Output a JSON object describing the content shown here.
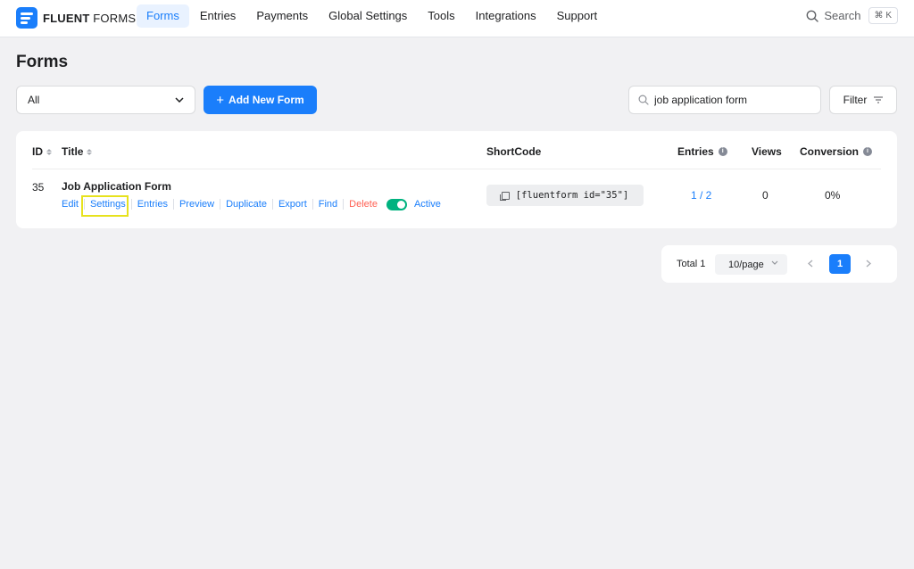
{
  "brand": {
    "name_bold": "FLUENT",
    "name_rest": " FORMS"
  },
  "nav": {
    "items": [
      {
        "label": "Forms",
        "active": true
      },
      {
        "label": "Entries"
      },
      {
        "label": "Payments"
      },
      {
        "label": "Global Settings"
      },
      {
        "label": "Tools"
      },
      {
        "label": "Integrations"
      },
      {
        "label": "Support"
      }
    ],
    "search_label": "Search",
    "search_shortcut": "⌘ K"
  },
  "page": {
    "title": "Forms"
  },
  "toolbar": {
    "filter_select_value": "All",
    "add_button_label": "Add New Form",
    "search_value": "job application form",
    "filter_label": "Filter"
  },
  "table": {
    "columns": {
      "id": "ID",
      "title": "Title",
      "shortcode": "ShortCode",
      "entries": "Entries",
      "views": "Views",
      "conversion": "Conversion"
    },
    "rows": [
      {
        "id": "35",
        "title": "Job Application Form",
        "actions": [
          "Edit",
          "Settings",
          "Entries",
          "Preview",
          "Duplicate",
          "Export",
          "Find",
          "Delete"
        ],
        "status": "Active",
        "shortcode": "[fluentform id=\"35\"]",
        "entries": "1 / 2",
        "views": "0",
        "conversion": "0%"
      }
    ]
  },
  "pagination": {
    "total": "Total 1",
    "per_page": "10/page",
    "current_page": "1"
  },
  "colors": {
    "accent": "#1a7efb",
    "danger": "#ff6154",
    "toggle_on": "#00b27f",
    "highlight": "#e7e21e"
  }
}
